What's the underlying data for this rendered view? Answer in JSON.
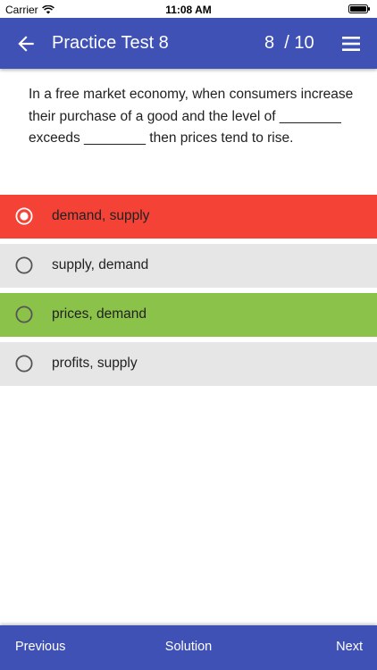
{
  "status": {
    "carrier": "Carrier",
    "time": "11:08 AM"
  },
  "appbar": {
    "title": "Practice Test 8",
    "counter": "8  / 10"
  },
  "question": {
    "text": "In a free market economy, when consumers increase their purchase of a good and the level of ________ exceeds ________ then prices tend to rise."
  },
  "options": [
    {
      "label": "demand, supply",
      "state": "selected-wrong",
      "color": "#f44336"
    },
    {
      "label": "supply, demand",
      "state": "unselected",
      "color": "#e6e6e6"
    },
    {
      "label": "prices, demand",
      "state": "correct",
      "color": "#8bc34a"
    },
    {
      "label": "profits, supply",
      "state": "unselected",
      "color": "#e6e6e6"
    }
  ],
  "bottombar": {
    "previous": "Previous",
    "solution": "Solution",
    "next": "Next"
  },
  "colors": {
    "primary": "#3f51b5",
    "wrong": "#f44336",
    "correct": "#8bc34a",
    "neutral": "#e6e6e6"
  }
}
